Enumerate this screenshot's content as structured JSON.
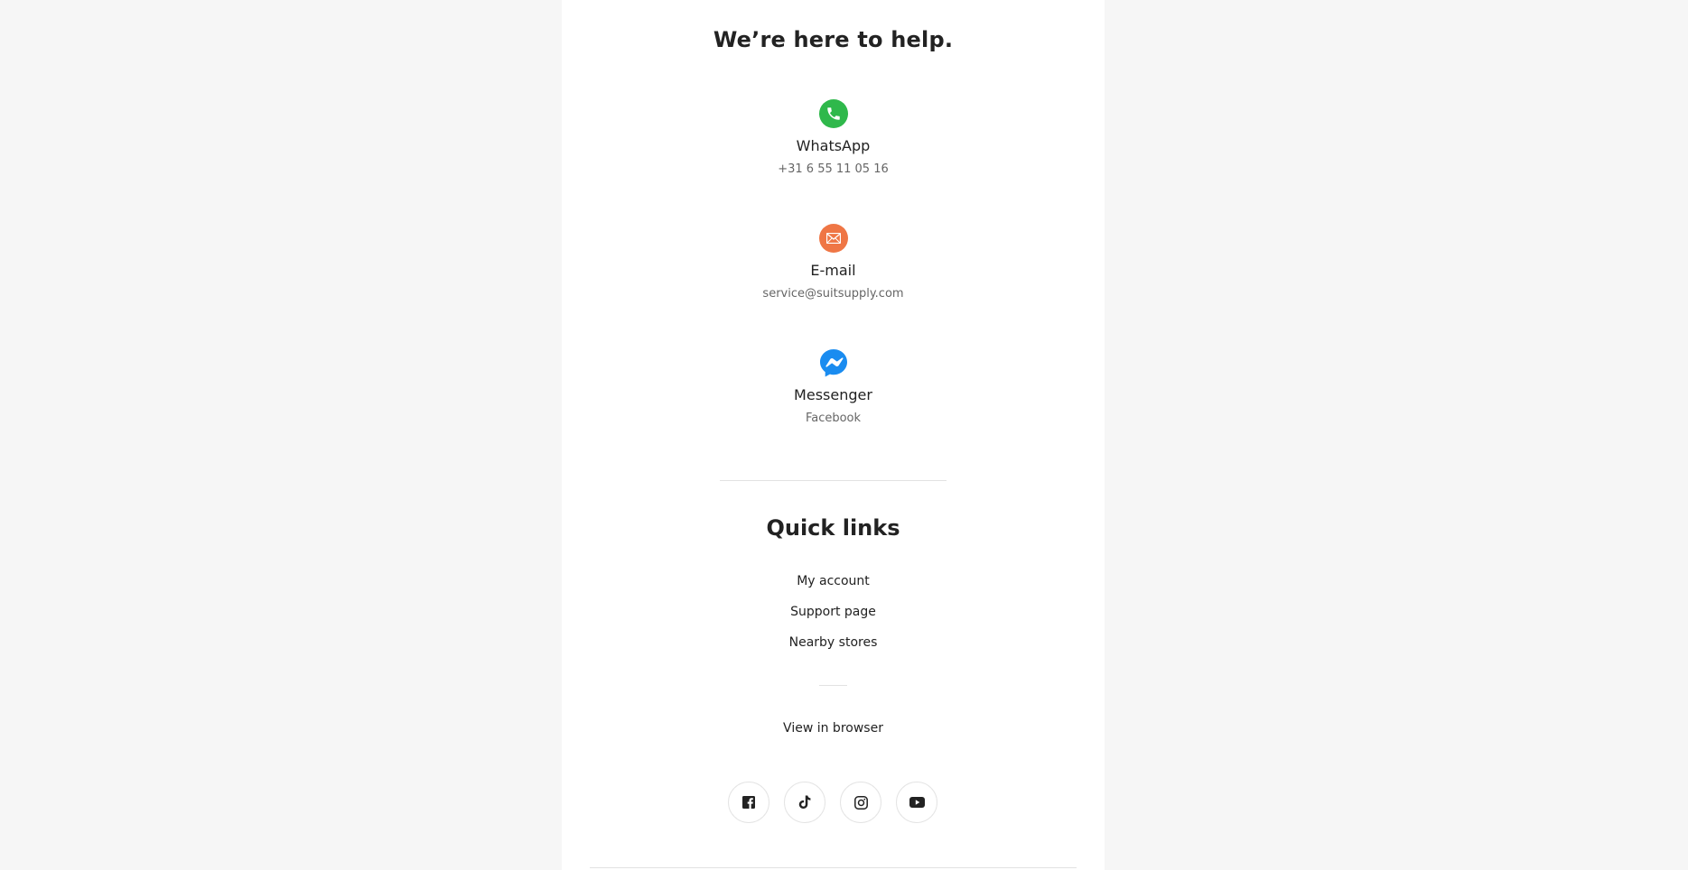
{
  "help": {
    "heading": "We’re here to help.",
    "contacts": [
      {
        "title": "WhatsApp",
        "sub": "+31 6 55 11 05 16",
        "icon": "whatsapp-icon",
        "color": "#2fb84b"
      },
      {
        "title": "E-mail",
        "sub": "service@suitsupply.com",
        "icon": "email-icon",
        "color": "#ef7645"
      },
      {
        "title": "Messenger",
        "sub": "Facebook",
        "icon": "messenger-icon",
        "color": "#1a8cf0"
      }
    ]
  },
  "quick_links": {
    "heading": "Quick links",
    "items": [
      "My account",
      "Support page",
      "Nearby stores"
    ]
  },
  "view_in_browser": "View in browser",
  "social": [
    "facebook-icon",
    "tiktok-icon",
    "instagram-icon",
    "youtube-icon"
  ]
}
